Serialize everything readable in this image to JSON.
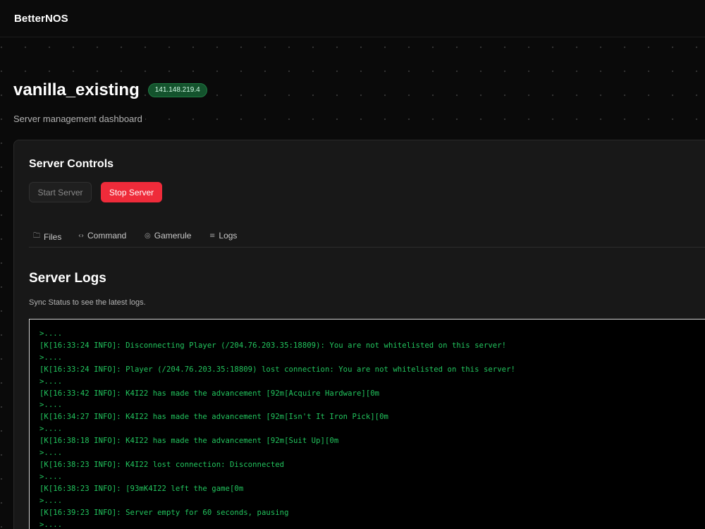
{
  "app": {
    "brand": "BetterNOS"
  },
  "server": {
    "name": "vanilla_existing",
    "ip": "141.148.219.4",
    "subtitle": "Server management dashboard"
  },
  "controls": {
    "title": "Server Controls",
    "start_label": "Start Server",
    "stop_label": "Stop Server"
  },
  "tabs": [
    {
      "label": "Files",
      "icon": "folder-icon"
    },
    {
      "label": "Command",
      "icon": "code-icon"
    },
    {
      "label": "Gamerule",
      "icon": "target-icon"
    },
    {
      "label": "Logs",
      "icon": "list-icon"
    }
  ],
  "logs": {
    "title": "Server Logs",
    "hint": "Sync Status to see the latest logs.",
    "lines": [
      ">....",
      "[K[16:33:24 INFO]: Disconnecting Player (/204.76.203.35:18809): You are not whitelisted on this server!",
      ">....",
      "[K[16:33:24 INFO]: Player (/204.76.203.35:18809) lost connection: You are not whitelisted on this server!",
      ">....",
      "[K[16:33:42 INFO]: K4I22 has made the advancement [92m[Acquire Hardware][0m",
      ">....",
      "[K[16:34:27 INFO]: K4I22 has made the advancement [92m[Isn't It Iron Pick][0m",
      ">....",
      "[K[16:38:18 INFO]: K4I22 has made the advancement [92m[Suit Up][0m",
      ">....",
      "[K[16:38:23 INFO]: K4I22 lost connection: Disconnected",
      ">....",
      "[K[16:38:23 INFO]: [93mK4I22 left the game[0m",
      ">....",
      "[K[16:39:23 INFO]: Server empty for 60 seconds, pausing",
      ">...."
    ]
  },
  "colors": {
    "accent_stop": "#ef2b3a",
    "badge_green": "#14532d",
    "log_text": "#22c55e"
  }
}
